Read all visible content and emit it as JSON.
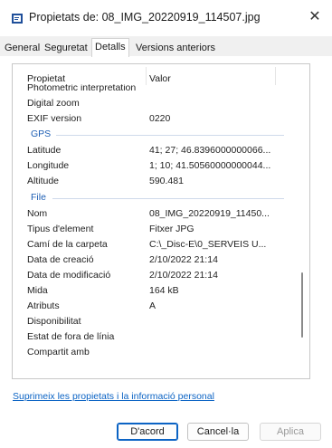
{
  "window": {
    "title": "Propietats de: 08_IMG_20220919_114507.jpg",
    "close_icon": "close-icon"
  },
  "tabs": [
    {
      "label": "General"
    },
    {
      "label": "Seguretat"
    },
    {
      "label": "Detalls",
      "active": true
    },
    {
      "label": "Versions anteriors"
    }
  ],
  "list": {
    "headers": {
      "property": "Propietat",
      "value": "Valor"
    },
    "rows": [
      {
        "k": "Photometric interpretation",
        "v": ""
      },
      {
        "k": "Digital zoom",
        "v": ""
      },
      {
        "k": "EXIF version",
        "v": "0220"
      }
    ],
    "gps_group": "GPS",
    "gps_rows": [
      {
        "k": "Latitude",
        "v": "41; 27; 46.8396000000066..."
      },
      {
        "k": "Longitude",
        "v": "1; 10; 41.50560000000044..."
      },
      {
        "k": "Altitude",
        "v": "590.481"
      }
    ],
    "file_group": "File",
    "file_rows": [
      {
        "k": "Nom",
        "v": "08_IMG_20220919_11450..."
      },
      {
        "k": "Tipus d'element",
        "v": "Fitxer JPG"
      },
      {
        "k": "Camí de la carpeta",
        "v": "C:\\_Disc-E\\0_SERVEIS U..."
      },
      {
        "k": "Data de creació",
        "v": "2/10/2022 21:14"
      },
      {
        "k": "Data de modificació",
        "v": "2/10/2022 21:14"
      },
      {
        "k": "Mida",
        "v": "164 kB"
      },
      {
        "k": "Atributs",
        "v": "A"
      },
      {
        "k": "Disponibilitat",
        "v": ""
      },
      {
        "k": "Estat de fora de línia",
        "v": ""
      },
      {
        "k": "Compartit amb",
        "v": ""
      }
    ]
  },
  "link": "Suprimeix les propietats i la informació personal",
  "buttons": {
    "ok": "D'acord",
    "cancel": "Cancel·la",
    "apply": "Aplica"
  },
  "colors": {
    "accent": "#0b63c4",
    "group": "#1e5fb4"
  }
}
